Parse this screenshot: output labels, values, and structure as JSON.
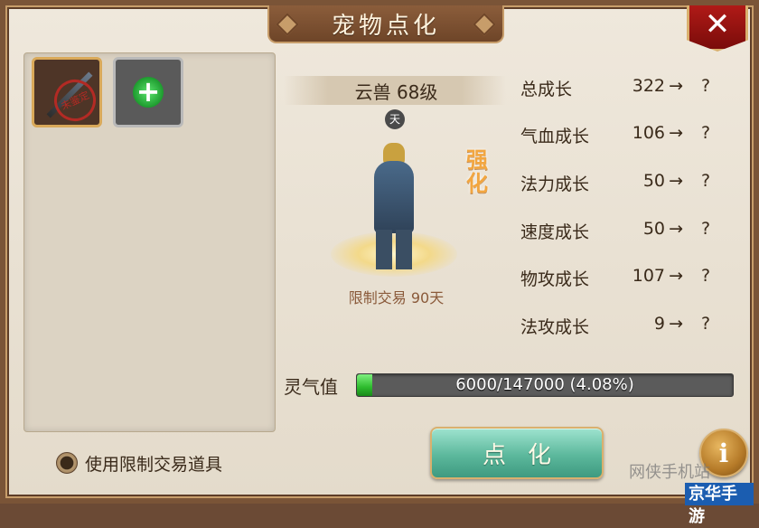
{
  "window": {
    "title": "宠物点化"
  },
  "pet": {
    "name_level": "云兽 68级",
    "rank_badge": "天",
    "enhance_tag": "强化",
    "trade_limit": "限制交易 90天"
  },
  "slots": {
    "item_seal": "未鉴定",
    "add_icon": "plus-icon"
  },
  "stats": [
    {
      "label": "总成长",
      "value": "322",
      "arrow": "→",
      "new": "?"
    },
    {
      "label": "气血成长",
      "value": "106",
      "arrow": "→",
      "new": "?"
    },
    {
      "label": "法力成长",
      "value": "50",
      "arrow": "→",
      "new": "?"
    },
    {
      "label": "速度成长",
      "value": "50",
      "arrow": "→",
      "new": "?"
    },
    {
      "label": "物攻成长",
      "value": "107",
      "arrow": "→",
      "new": "?"
    },
    {
      "label": "法攻成长",
      "value": "9",
      "arrow": "→",
      "new": "?"
    }
  ],
  "spirit": {
    "label": "灵气值",
    "text": "6000/147000 (4.08%)",
    "fraction": 0.0408
  },
  "bottom": {
    "use_limited_label": "使用限制交易道具",
    "dianhua_label": "点化",
    "info_label": "i"
  },
  "close_label": "✕",
  "watermark": {
    "top": "网侠手机站",
    "bottom": "京华手游"
  }
}
